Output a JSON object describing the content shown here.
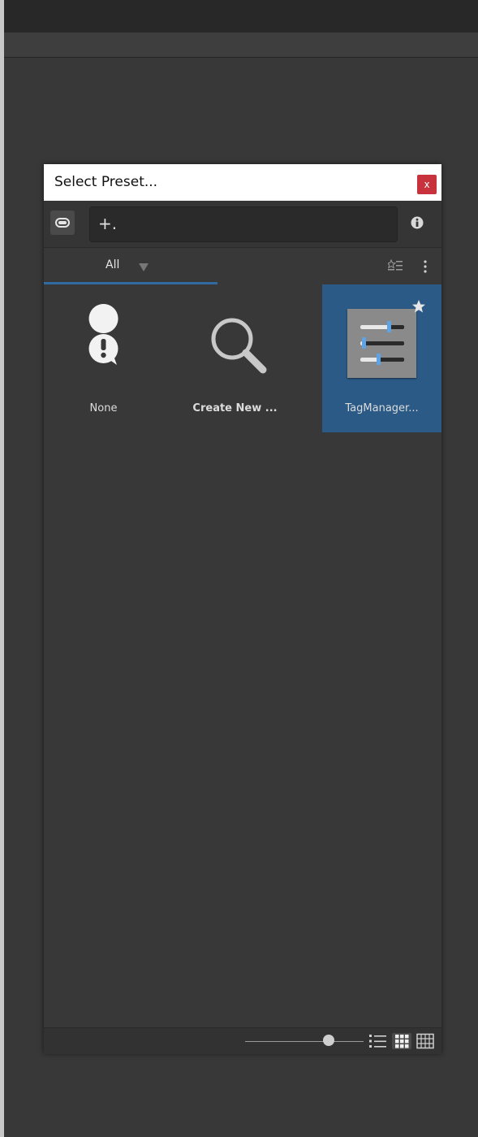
{
  "dialog": {
    "title": "Select Preset...",
    "close_label": "x"
  },
  "search": {
    "plus_label": "+.",
    "value": ""
  },
  "tabs": [
    {
      "label": "All",
      "active": true
    }
  ],
  "items": [
    {
      "label": "None",
      "icon": "warning-bubble-icon",
      "selected": false,
      "bold": false
    },
    {
      "label": "Create New ...",
      "icon": "magnifier-icon",
      "selected": false,
      "bold": true
    },
    {
      "label": "TagManager...",
      "icon": "preset-sliders-icon",
      "selected": true,
      "favorite": true,
      "bold": false
    }
  ],
  "footer": {
    "zoom_level": 0.66,
    "view_modes": [
      "list-view-icon",
      "grid-view-icon",
      "table-view-icon"
    ],
    "active_view": "grid-view-icon"
  },
  "colors": {
    "selection": "#2b5a86",
    "tab_underline": "#2f6aa0",
    "close_button": "#c8323c"
  }
}
